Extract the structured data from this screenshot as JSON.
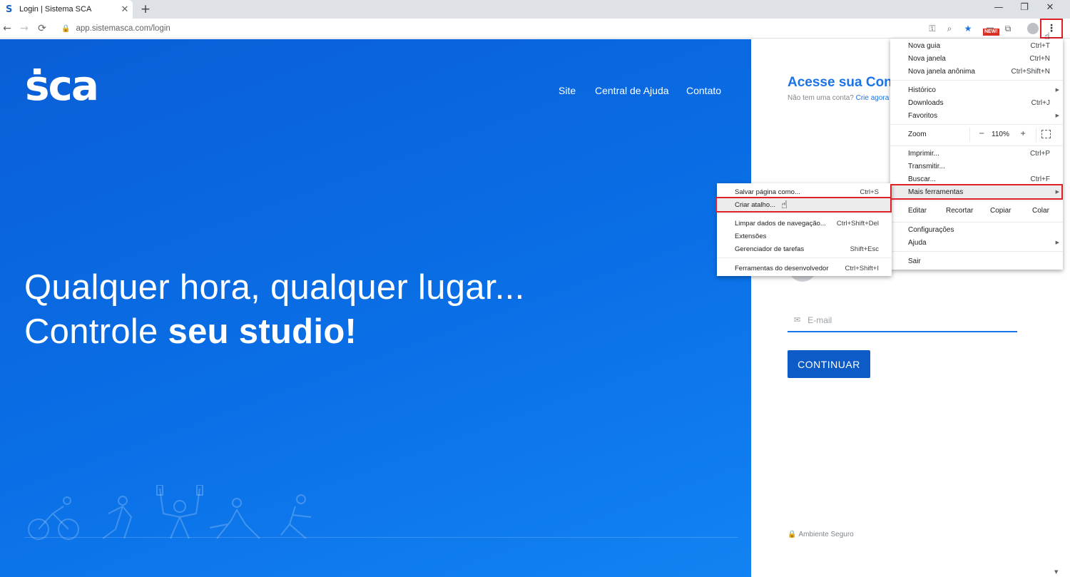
{
  "browser": {
    "tab_title": "Login | Sistema SCA",
    "tab_favicon": "S",
    "tab_close": "✕",
    "new_tab": "+",
    "window_controls": {
      "minimize": "—",
      "maximize": "❐",
      "close": "✕"
    },
    "nav": {
      "back": "←",
      "forward": "→",
      "reload": "⟳"
    },
    "url": "app.sistemasca.com/login",
    "new_badge": "NEW!",
    "icons": [
      "key-icon",
      "zoom-icon",
      "bookmark-star-icon",
      "extension-icon",
      "cast-icon",
      "profile-icon",
      "kebab-menu-icon"
    ]
  },
  "hero": {
    "logo": "ṡca",
    "nav_links": [
      "Site",
      "Central de Ajuda",
      "Contato"
    ],
    "headline_line1": "Qualquer hora, qualquer lugar...",
    "headline_line2_normal": "Controle ",
    "headline_line2_bold": "seu studio!"
  },
  "login": {
    "title": "Acesse sua Conta",
    "subtitle": "Não tem uma conta?",
    "subtitle_link": "Crie agora",
    "email_placeholder": "E-mail",
    "continue_label": "CONTINUAR",
    "secure_label": "Ambiente Seguro"
  },
  "chrome_menu": {
    "items": [
      {
        "label": "Nova guia",
        "shortcut": "Ctrl+T"
      },
      {
        "label": "Nova janela",
        "shortcut": "Ctrl+N"
      },
      {
        "label": "Nova janela anônima",
        "shortcut": "Ctrl+Shift+N"
      },
      {
        "label": "Histórico",
        "shortcut": ""
      },
      {
        "label": "Downloads",
        "shortcut": "Ctrl+J"
      },
      {
        "label": "Favoritos",
        "shortcut": ""
      },
      {
        "label": "Imprimir...",
        "shortcut": "Ctrl+P"
      },
      {
        "label": "Transmitir...",
        "shortcut": ""
      },
      {
        "label": "Buscar...",
        "shortcut": "Ctrl+F"
      },
      {
        "label": "Mais ferramentas",
        "shortcut": ""
      },
      {
        "label": "Configurações",
        "shortcut": ""
      },
      {
        "label": "Ajuda",
        "shortcut": ""
      },
      {
        "label": "Sair",
        "shortcut": ""
      }
    ],
    "zoom": {
      "label": "Zoom",
      "minus": "−",
      "value": "110%",
      "plus": "+"
    },
    "edit": {
      "label": "Editar",
      "cut": "Recortar",
      "copy": "Copiar",
      "paste": "Colar"
    },
    "arrow": "▶"
  },
  "submenu": {
    "items": [
      {
        "label": "Salvar página como...",
        "shortcut": "Ctrl+S"
      },
      {
        "label": "Criar atalho...",
        "shortcut": ""
      },
      {
        "label": "Limpar dados de navegação...",
        "shortcut": "Ctrl+Shift+Del"
      },
      {
        "label": "Extensões",
        "shortcut": ""
      },
      {
        "label": "Gerenciador de tarefas",
        "shortcut": "Shift+Esc"
      },
      {
        "label": "Ferramentas do desenvolvedor",
        "shortcut": "Ctrl+Shift+I"
      }
    ]
  },
  "colors": {
    "hero_blue": "#0a6fe6",
    "accent_blue": "#1a73e8",
    "button_blue": "#0d5bc6",
    "highlight_red": "#e01f26"
  }
}
